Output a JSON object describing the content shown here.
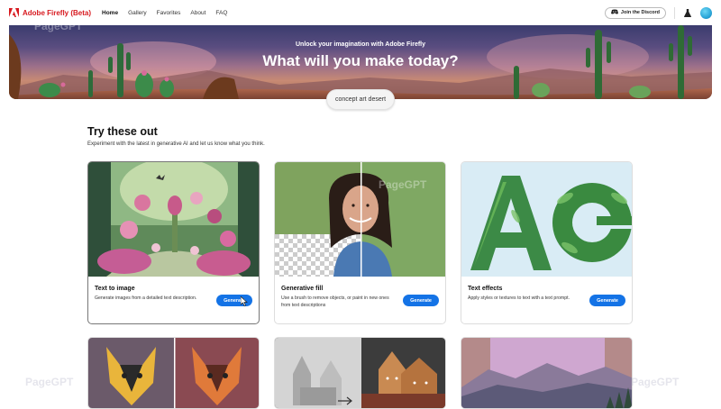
{
  "nav": {
    "brand": "Adobe Firefly (Beta)",
    "links": [
      {
        "label": "Home",
        "active": true
      },
      {
        "label": "Gallery"
      },
      {
        "label": "Favorites"
      },
      {
        "label": "About"
      },
      {
        "label": "FAQ"
      }
    ],
    "discord_label": "Join the Discord",
    "icons": [
      "adobe-logo-icon",
      "discord-icon",
      "flask-icon",
      "avatar"
    ]
  },
  "hero": {
    "subtitle": "Unlock your imagination with Adobe Firefly",
    "title": "What will you make today?",
    "prompt": "concept art desert"
  },
  "section": {
    "title": "Try these out",
    "description": "Experiment with the latest in generative AI and let us know what you think."
  },
  "cards": [
    {
      "title": "Text to image",
      "description": "Generate images from a detailed text description.",
      "button": "Generate"
    },
    {
      "title": "Generative fill",
      "description": "Use a brush to remove objects, or paint in new ones from text descriptions",
      "button": "Generate"
    },
    {
      "title": "Text effects",
      "description": "Apply styles or textures to text with a text prompt.",
      "button": "Generate"
    }
  ],
  "watermark": "PageGPT",
  "colors": {
    "brand_red": "#d7191f",
    "button_blue": "#1473e6"
  }
}
